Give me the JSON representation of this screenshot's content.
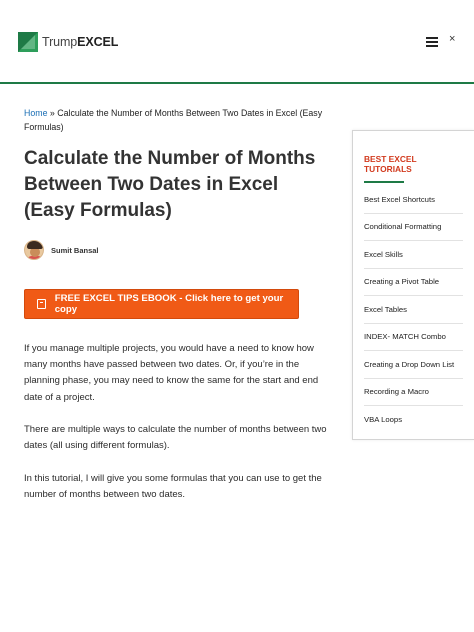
{
  "header": {
    "brand_regular": "Trump",
    "brand_bold": "EXCEL",
    "close_glyph": "×"
  },
  "breadcrumb": {
    "home": "Home",
    "separator": " » ",
    "current": "Calculate the Number of Months Between Two Dates in Excel (Easy Formulas)"
  },
  "article": {
    "title": "Calculate the Number of Months Between Two Dates in Excel (Easy Formulas)",
    "author": "Sumit Bansal",
    "cta_label": "FREE EXCEL TIPS EBOOK - Click here to get your copy",
    "paragraphs": [
      "If you manage multiple projects, you would have a need to know how many months have passed between two dates. Or, if you’re in the planning phase, you may need to know the same for the start and end date of a project.",
      "There are multiple ways to calculate the number of months between two dates (all using different formulas).",
      "In this tutorial, I will give you some formulas that you can use to get the number of months between two dates."
    ]
  },
  "sidebar": {
    "title": "BEST EXCEL TUTORIALS",
    "items": [
      "Best Excel Shortcuts",
      "Conditional Formatting",
      "Excel Skills",
      "Creating a Pivot Table",
      "Excel Tables",
      "INDEX- MATCH Combo",
      "Creating a Drop Down List",
      "Recording a Macro",
      "VBA Loops"
    ]
  },
  "colors": {
    "brand_green": "#1e7a46",
    "cta_orange": "#f05a16",
    "sidebar_title_red": "#d23a1e",
    "link_blue": "#1b6fb5"
  },
  "icons": [
    "logo-icon",
    "menu-icon",
    "close-icon",
    "avatar",
    "ebook-icon"
  ]
}
